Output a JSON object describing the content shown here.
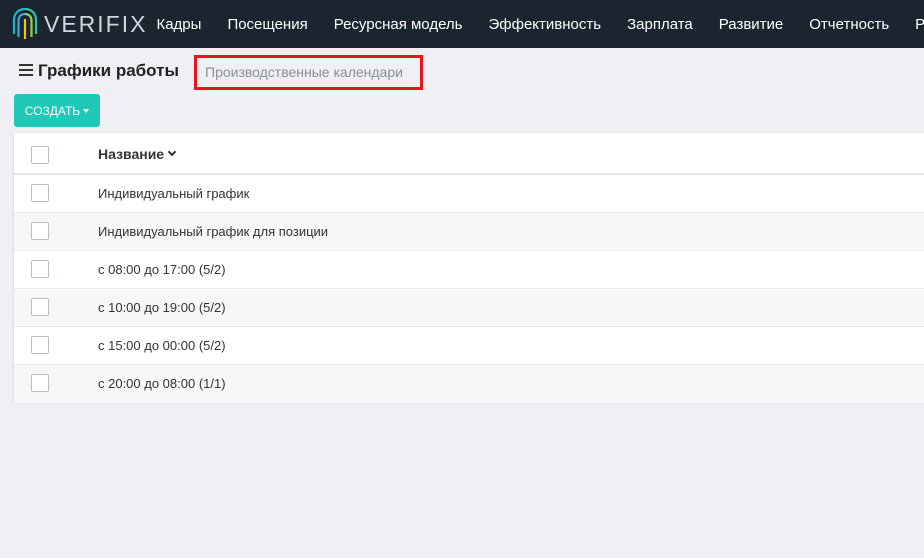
{
  "app": {
    "logo_text": "VERIFIX"
  },
  "nav": [
    "Кадры",
    "Посещения",
    "Ресурсная модель",
    "Эффективность",
    "Зарплата",
    "Развитие",
    "Отчетность",
    "Р"
  ],
  "page": {
    "title": "Графики работы",
    "calendars_link": "Производственные календари",
    "create_button": "СОЗДАТЬ"
  },
  "table": {
    "column_name": "Название",
    "rows": [
      "Индивидуальный график",
      "Индивидуальный график для позиции",
      "с 08:00 до 17:00 (5/2)",
      "с 10:00 до 19:00 (5/2)",
      "с 15:00 до 00:00 (5/2)",
      "с 20:00 до 08:00 (1/1)"
    ]
  },
  "colors": {
    "topbar": "#1b2530",
    "accent": "#1fc8b7",
    "highlight_box": "#e8141b"
  }
}
